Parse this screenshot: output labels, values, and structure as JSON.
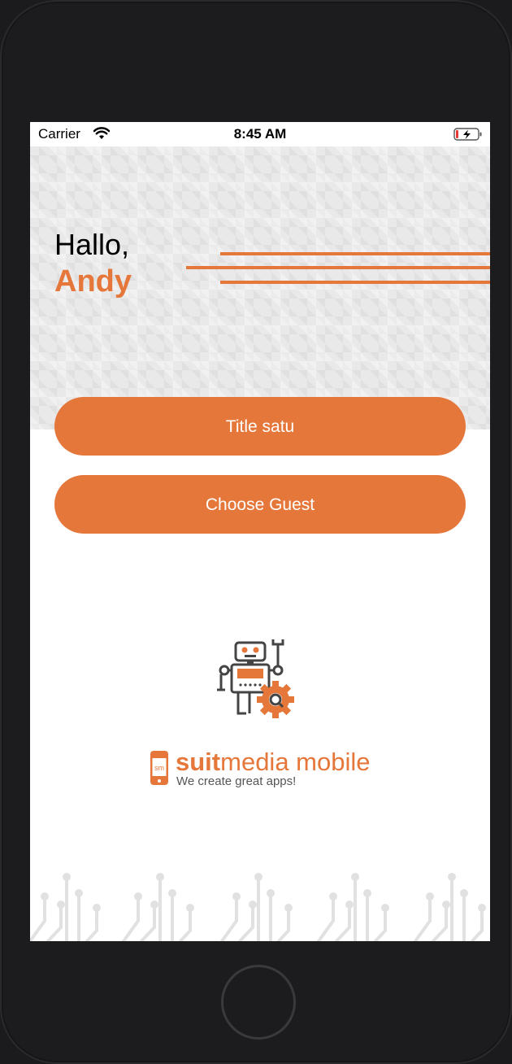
{
  "status_bar": {
    "carrier": "Carrier",
    "time": "8:45 AM",
    "icons": [
      "wifi-icon",
      "battery-charging-icon"
    ]
  },
  "header": {
    "greeting": "Hallo,",
    "name": "Andy"
  },
  "buttons": {
    "primary_label": "Title satu",
    "secondary_label": "Choose Guest"
  },
  "brand": {
    "name_bold": "suit",
    "name_rest": "media mobile",
    "tagline": "We create great apps!",
    "icon": "robot-gear-icon"
  },
  "colors": {
    "accent": "#e5773a",
    "frame": "#1c1c1e"
  }
}
